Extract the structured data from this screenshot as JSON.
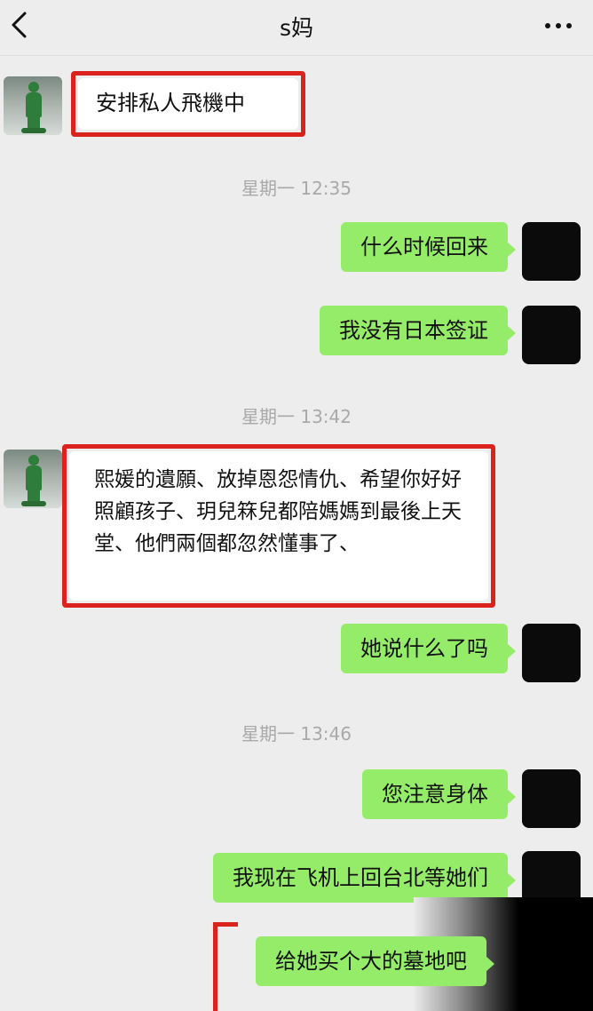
{
  "header": {
    "back_icon": "chevron-left-icon",
    "title": "s妈",
    "more_icon": "more-dots-icon"
  },
  "messages": [
    {
      "side": "in",
      "text": "安排私人飛機中",
      "highlighted": true
    },
    {
      "side": "out",
      "text": "什么时候回来"
    },
    {
      "side": "out",
      "text": "我没有日本签证"
    },
    {
      "side": "in",
      "text": "熙媛的遺願、放掉恩怨情仇、希望你好好照顧孩子、玥兒箖兒都陪媽媽到最後上天堂、他們兩個都忽然懂事了、",
      "highlighted": true
    },
    {
      "side": "out",
      "text": "她说什么了吗"
    },
    {
      "side": "out",
      "text": "您注意身体"
    },
    {
      "side": "out",
      "text": "我现在飞机上回台北等她们"
    },
    {
      "side": "out",
      "text": "给她买个大的墓地吧",
      "highlighted": true
    }
  ],
  "timestamps": [
    "星期一 12:35",
    "星期一 13:42",
    "星期一 13:46"
  ],
  "colors": {
    "background": "#ededed",
    "outgoing_bubble": "#95ec69",
    "incoming_bubble": "#ffffff",
    "highlight_border": "#d9231c",
    "timestamp_text": "#a9a9a9"
  }
}
